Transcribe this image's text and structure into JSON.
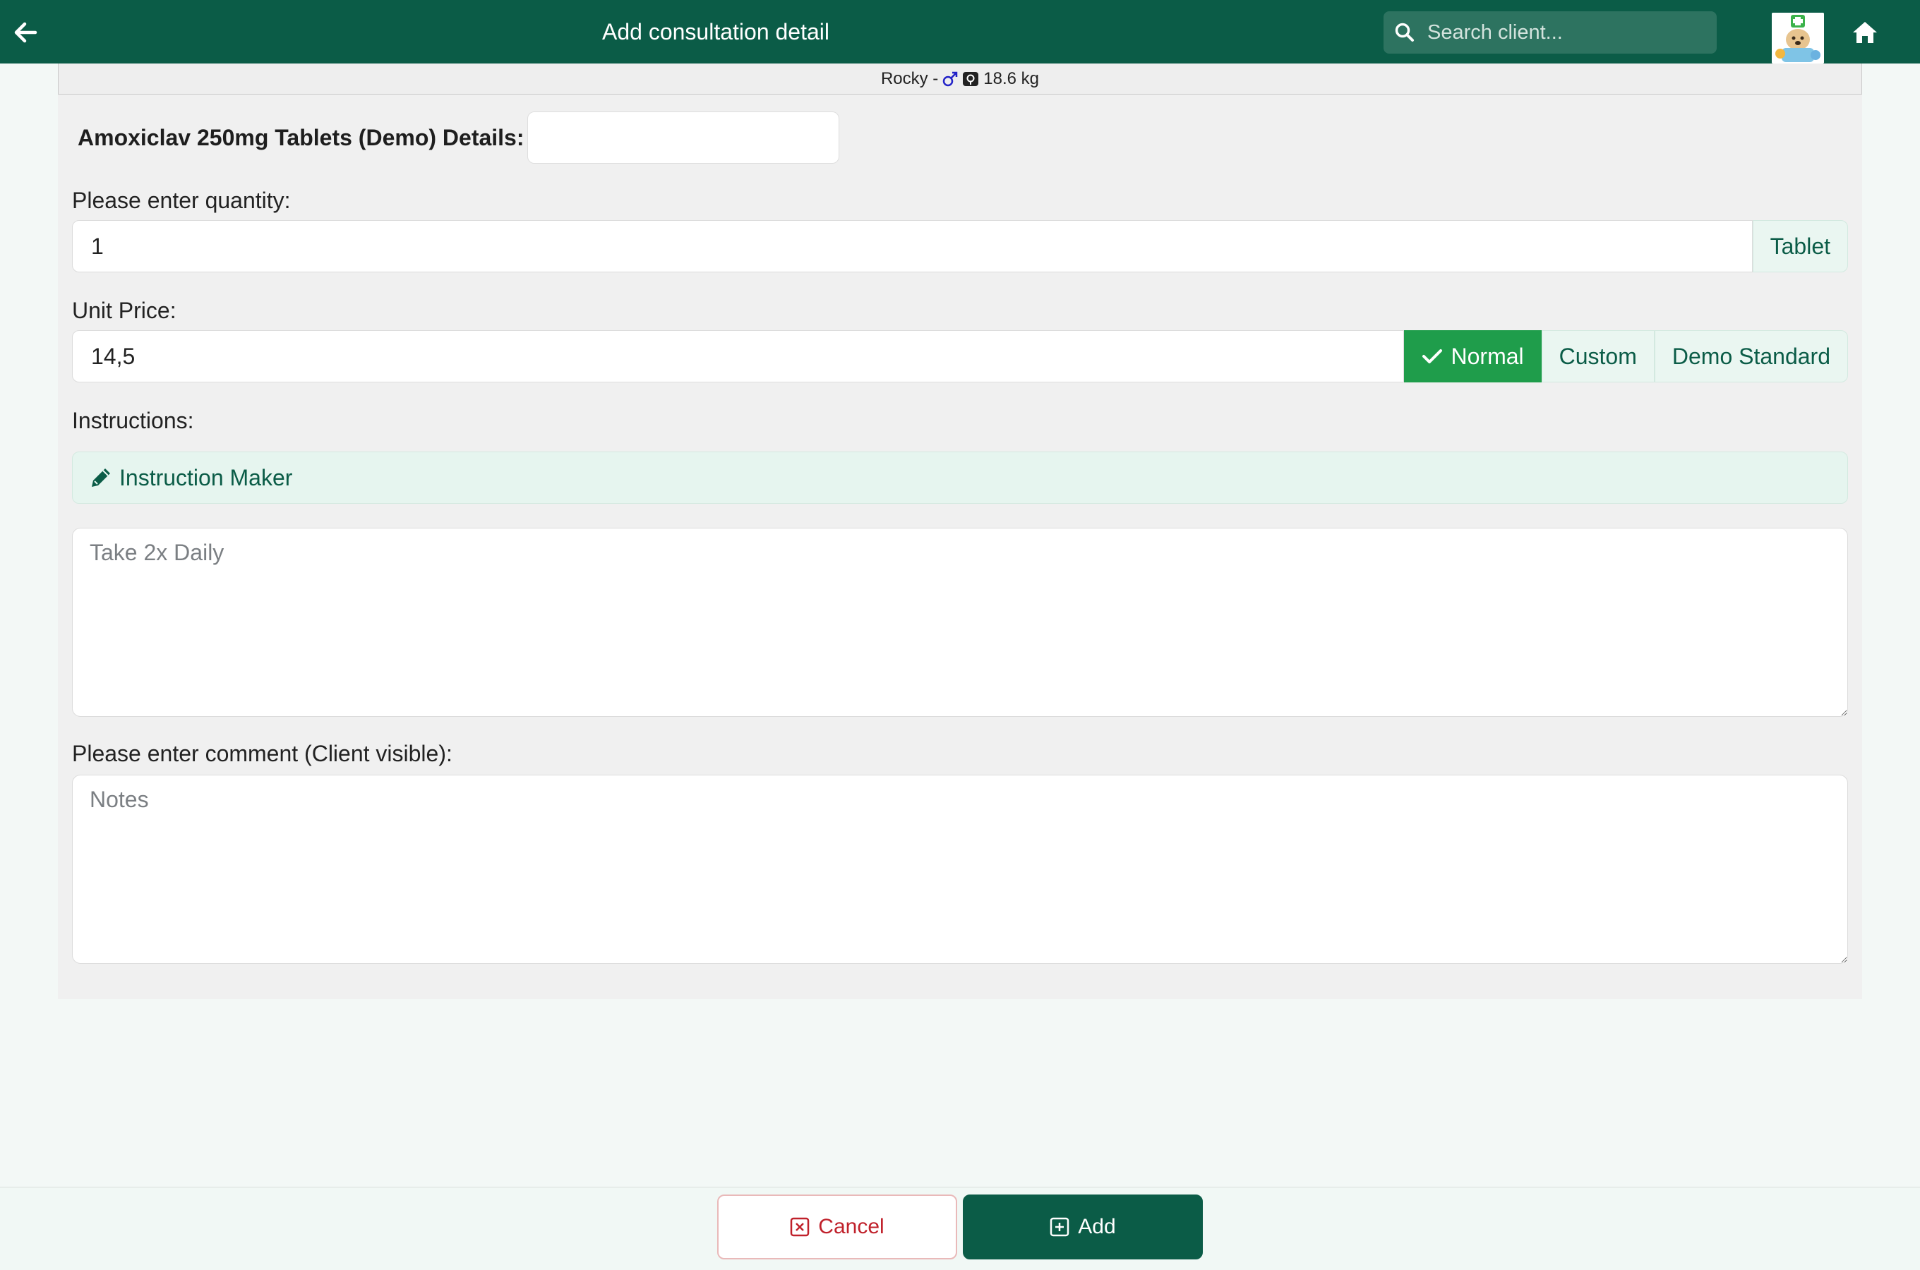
{
  "header": {
    "title": "Add consultation detail",
    "search_placeholder": "Search client..."
  },
  "patient": {
    "name_prefix": "Rocky -",
    "weight": "18.6 kg"
  },
  "form": {
    "details_label": "Amoxiclav 250mg Tablets (Demo) Details:",
    "details_value": "",
    "quantity_label": "Please enter quantity:",
    "quantity_value": "1",
    "quantity_unit": "Tablet",
    "price_label": "Unit Price:",
    "price_value": "14,5",
    "price_options": {
      "normal": "Normal",
      "custom": "Custom",
      "demo_standard": "Demo Standard"
    },
    "selected_price_option": "Normal",
    "instructions_label": "Instructions:",
    "instruction_maker_label": "Instruction Maker",
    "instructions_placeholder": "Take 2x Daily",
    "comment_label": "Please enter comment (Client visible):",
    "comment_placeholder": "Notes"
  },
  "footer": {
    "cancel_label": "Cancel",
    "add_label": "Add"
  },
  "colors": {
    "header_bg": "#0b5c47",
    "active_green": "#1f9d4b",
    "cancel_red": "#c0212b"
  }
}
